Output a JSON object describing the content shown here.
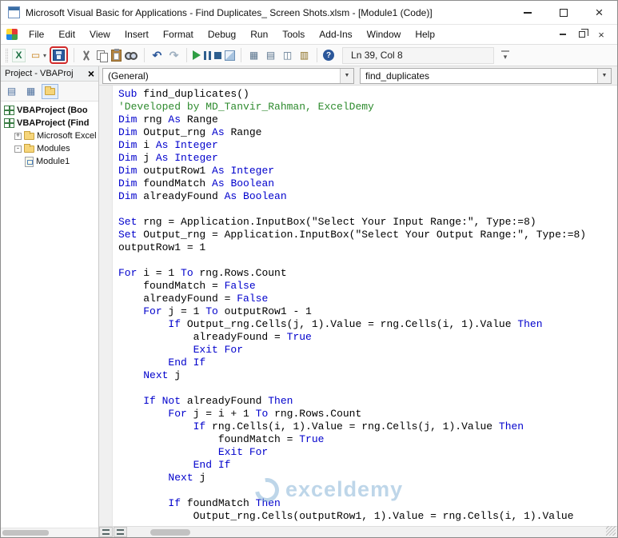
{
  "window": {
    "title": "Microsoft Visual Basic for Applications - Find Duplicates_ Screen Shots.xlsm - [Module1 (Code)]"
  },
  "menu": {
    "items": [
      "File",
      "Edit",
      "View",
      "Insert",
      "Format",
      "Debug",
      "Run",
      "Tools",
      "Add-Ins",
      "Window",
      "Help"
    ]
  },
  "toolbar": {
    "status": "Ln 39, Col 8",
    "save_highlight_color": "#D22A2A",
    "icons": [
      {
        "name": "view-excel-icon",
        "glyph": "X",
        "color": "#1E7145"
      },
      {
        "name": "insert-userform-icon",
        "glyph": "▭",
        "color": "#C77F16",
        "dropdown": true
      },
      {
        "name": "save-icon",
        "highlight": true
      },
      {
        "sep": true
      },
      {
        "name": "cut-icon"
      },
      {
        "name": "copy-icon"
      },
      {
        "name": "paste-icon"
      },
      {
        "name": "find-icon"
      },
      {
        "sep": true
      },
      {
        "name": "undo-icon",
        "glyph": "↶",
        "color": "#2B579A"
      },
      {
        "name": "redo-icon",
        "glyph": "↷",
        "color": "#9FB0C0"
      },
      {
        "sep": true
      },
      {
        "name": "run-icon"
      },
      {
        "name": "break-icon"
      },
      {
        "name": "reset-icon"
      },
      {
        "name": "design-mode-icon"
      },
      {
        "sep": true
      },
      {
        "name": "project-explorer-icon",
        "glyph": "▦",
        "color": "#56718B"
      },
      {
        "name": "properties-window-icon",
        "glyph": "▤",
        "color": "#56718B"
      },
      {
        "name": "object-browser-icon",
        "glyph": "◫",
        "color": "#56718B"
      },
      {
        "name": "toolbox-icon",
        "glyph": "▥",
        "color": "#8A6D1F"
      },
      {
        "sep": true
      },
      {
        "name": "help-icon",
        "glyph": "?",
        "color": "#FFFFFF"
      }
    ]
  },
  "project_panel": {
    "title": "Project - VBAProj",
    "close": "×",
    "toolbar": [
      {
        "name": "view-code-icon",
        "glyph": "▤",
        "color": "#4A6D9C"
      },
      {
        "name": "view-object-icon",
        "glyph": "▦",
        "color": "#4A6D9C"
      },
      {
        "name": "toggle-folders-icon",
        "folder": true,
        "active": true
      }
    ],
    "tree": [
      {
        "label": "VBAProject (Boo",
        "icon": "project",
        "bold": true,
        "indent": 0
      },
      {
        "label": "VBAProject (Find",
        "icon": "project",
        "bold": true,
        "indent": 0
      },
      {
        "label": "Microsoft Excel",
        "icon": "folder",
        "indent": 1,
        "expander": "+"
      },
      {
        "label": "Modules",
        "icon": "folder",
        "indent": 1,
        "expander": "-"
      },
      {
        "label": "Module1",
        "icon": "module",
        "indent": 2
      }
    ]
  },
  "code_window": {
    "combo_left": "(General)",
    "combo_right": "find_duplicates",
    "watermark_text": "exceldemy",
    "colors": {
      "keyword": "#0000CC",
      "comment": "#2E8B2E",
      "text": "#000000",
      "watermark": "#7FAFD4"
    },
    "lines": [
      [
        [
          "k",
          "Sub"
        ],
        [
          "n",
          " find_duplicates()"
        ]
      ],
      [
        [
          "c",
          "'Developed by MD_Tanvir_Rahman, ExcelDemy"
        ]
      ],
      [
        [
          "k",
          "Dim"
        ],
        [
          "n",
          " rng "
        ],
        [
          "k",
          "As"
        ],
        [
          "n",
          " Range"
        ]
      ],
      [
        [
          "k",
          "Dim"
        ],
        [
          "n",
          " Output_rng "
        ],
        [
          "k",
          "As"
        ],
        [
          "n",
          " Range"
        ]
      ],
      [
        [
          "k",
          "Dim"
        ],
        [
          "n",
          " i "
        ],
        [
          "k",
          "As"
        ],
        [
          "n",
          " "
        ],
        [
          "k",
          "Integer"
        ]
      ],
      [
        [
          "k",
          "Dim"
        ],
        [
          "n",
          " j "
        ],
        [
          "k",
          "As"
        ],
        [
          "n",
          " "
        ],
        [
          "k",
          "Integer"
        ]
      ],
      [
        [
          "k",
          "Dim"
        ],
        [
          "n",
          " outputRow1 "
        ],
        [
          "k",
          "As"
        ],
        [
          "n",
          " "
        ],
        [
          "k",
          "Integer"
        ]
      ],
      [
        [
          "k",
          "Dim"
        ],
        [
          "n",
          " foundMatch "
        ],
        [
          "k",
          "As"
        ],
        [
          "n",
          " "
        ],
        [
          "k",
          "Boolean"
        ]
      ],
      [
        [
          "k",
          "Dim"
        ],
        [
          "n",
          " alreadyFound "
        ],
        [
          "k",
          "As"
        ],
        [
          "n",
          " "
        ],
        [
          "k",
          "Boolean"
        ]
      ],
      [],
      [
        [
          "k",
          "Set"
        ],
        [
          "n",
          " rng = Application.InputBox(\"Select Your Input Range:\", Type:=8)"
        ]
      ],
      [
        [
          "k",
          "Set"
        ],
        [
          "n",
          " Output_rng = Application.InputBox(\"Select Your Output Range:\", Type:=8)"
        ]
      ],
      [
        [
          "n",
          "outputRow1 = 1"
        ]
      ],
      [],
      [
        [
          "k",
          "For"
        ],
        [
          "n",
          " i = 1 "
        ],
        [
          "k",
          "To"
        ],
        [
          "n",
          " rng.Rows.Count"
        ]
      ],
      [
        [
          "n",
          "    foundMatch = "
        ],
        [
          "k",
          "False"
        ]
      ],
      [
        [
          "n",
          "    alreadyFound = "
        ],
        [
          "k",
          "False"
        ]
      ],
      [
        [
          "n",
          "    "
        ],
        [
          "k",
          "For"
        ],
        [
          "n",
          " j = 1 "
        ],
        [
          "k",
          "To"
        ],
        [
          "n",
          " outputRow1 - 1"
        ]
      ],
      [
        [
          "n",
          "        "
        ],
        [
          "k",
          "If"
        ],
        [
          "n",
          " Output_rng.Cells(j, 1).Value = rng.Cells(i, 1).Value "
        ],
        [
          "k",
          "Then"
        ]
      ],
      [
        [
          "n",
          "            alreadyFound = "
        ],
        [
          "k",
          "True"
        ]
      ],
      [
        [
          "n",
          "            "
        ],
        [
          "k",
          "Exit For"
        ]
      ],
      [
        [
          "n",
          "        "
        ],
        [
          "k",
          "End If"
        ]
      ],
      [
        [
          "n",
          "    "
        ],
        [
          "k",
          "Next"
        ],
        [
          "n",
          " j"
        ]
      ],
      [],
      [
        [
          "n",
          "    "
        ],
        [
          "k",
          "If Not"
        ],
        [
          "n",
          " alreadyFound "
        ],
        [
          "k",
          "Then"
        ]
      ],
      [
        [
          "n",
          "        "
        ],
        [
          "k",
          "For"
        ],
        [
          "n",
          " j = i + 1 "
        ],
        [
          "k",
          "To"
        ],
        [
          "n",
          " rng.Rows.Count"
        ]
      ],
      [
        [
          "n",
          "            "
        ],
        [
          "k",
          "If"
        ],
        [
          "n",
          " rng.Cells(i, 1).Value = rng.Cells(j, 1).Value "
        ],
        [
          "k",
          "Then"
        ]
      ],
      [
        [
          "n",
          "                foundMatch = "
        ],
        [
          "k",
          "True"
        ]
      ],
      [
        [
          "n",
          "                "
        ],
        [
          "k",
          "Exit For"
        ]
      ],
      [
        [
          "n",
          "            "
        ],
        [
          "k",
          "End If"
        ]
      ],
      [
        [
          "n",
          "        "
        ],
        [
          "k",
          "Next"
        ],
        [
          "n",
          " j"
        ]
      ],
      [],
      [
        [
          "n",
          "        "
        ],
        [
          "k",
          "If"
        ],
        [
          "n",
          " foundMatch "
        ],
        [
          "k",
          "Then"
        ]
      ],
      [
        [
          "n",
          "            Output_rng.Cells(outputRow1, 1).Value = rng.Cells(i, 1).Value"
        ]
      ]
    ]
  }
}
